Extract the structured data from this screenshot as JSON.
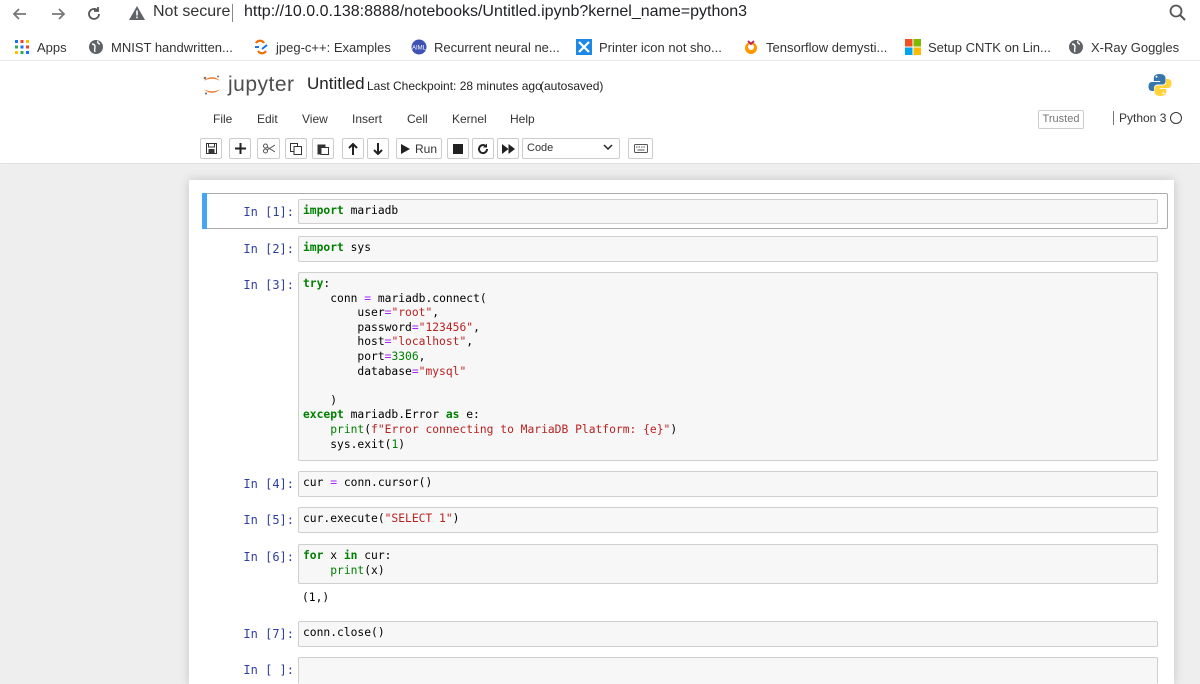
{
  "browser": {
    "not_secure": "Not secure",
    "url": "http://10.0.0.138:8888/notebooks/Untitled.ipynb?kernel_name=python3"
  },
  "bookmarks": [
    {
      "label": "Apps",
      "icon": "apps-grid-icon"
    },
    {
      "label": "MNIST handwritten...",
      "icon": "globe-icon"
    },
    {
      "label": "jpeg-c++: Examples",
      "icon": "cplusplus-icon"
    },
    {
      "label": "Recurrent neural ne...",
      "icon": "aiml-icon"
    },
    {
      "label": "Printer icon not sho...",
      "icon": "x-logo-icon"
    },
    {
      "label": "Tensorflow demysti...",
      "icon": "tensorflow-icon"
    },
    {
      "label": "Setup CNTK on Lin...",
      "icon": "microsoft-icon"
    },
    {
      "label": "X-Ray Goggles",
      "icon": "globe-icon"
    }
  ],
  "jupyter": {
    "logo_text": "jupyter",
    "notebook_title": "Untitled",
    "checkpoint": "Last Checkpoint: 28 minutes ago",
    "autosave": "(autosaved)",
    "menu": [
      "File",
      "Edit",
      "View",
      "Insert",
      "Cell",
      "Kernel",
      "Help"
    ],
    "trusted": "Trusted",
    "kernel": "Python 3",
    "toolbar": {
      "run_label": "Run",
      "cell_type": "Code"
    }
  },
  "cells": [
    {
      "prompt": "In [1]:"
    },
    {
      "prompt": "In [2]:"
    },
    {
      "prompt": "In [3]:"
    },
    {
      "prompt": "In [4]:"
    },
    {
      "prompt": "In [5]:"
    },
    {
      "prompt": "In [6]:",
      "output": "(1,)"
    },
    {
      "prompt": "In [7]:"
    },
    {
      "prompt": "In [ ]:"
    }
  ],
  "code": {
    "c1_kw": "import",
    "c1_rest": " mariadb",
    "c2_kw": "import",
    "c2_rest": " sys",
    "c3_try": "try",
    "c3_l1": "conn",
    "c3_l1b": "mariadb.connect(",
    "c3_user_k": "user",
    "c3_user_v": "\"root\"",
    "c3_pw_k": "password",
    "c3_pw_v": "\"123456\"",
    "c3_host_k": "host",
    "c3_host_v": "\"localhost\"",
    "c3_port_k": "port",
    "c3_port_v": "3306",
    "c3_db_k": "database",
    "c3_db_v": "\"mysql\"",
    "c3_except": "except",
    "c3_exc_mid": " mariadb.Error ",
    "c3_as": "as",
    "c3_e": " e:",
    "c3_print": "print",
    "c3_fstr": "f\"Error connecting to MariaDB Platform: {e}\"",
    "c3_exit": "sys.exit(",
    "c3_exit_n": "1",
    "c4_a": "cur",
    "c4_b": "conn.cursor()",
    "c5_a": "cur.execute(",
    "c5_s": "\"SELECT 1\"",
    "c6_for": "for",
    "c6_x": " x ",
    "c6_in": "in",
    "c6_cur": " cur:",
    "c6_print": "print",
    "c6_arg": "(x)",
    "c7": "conn.close()"
  }
}
